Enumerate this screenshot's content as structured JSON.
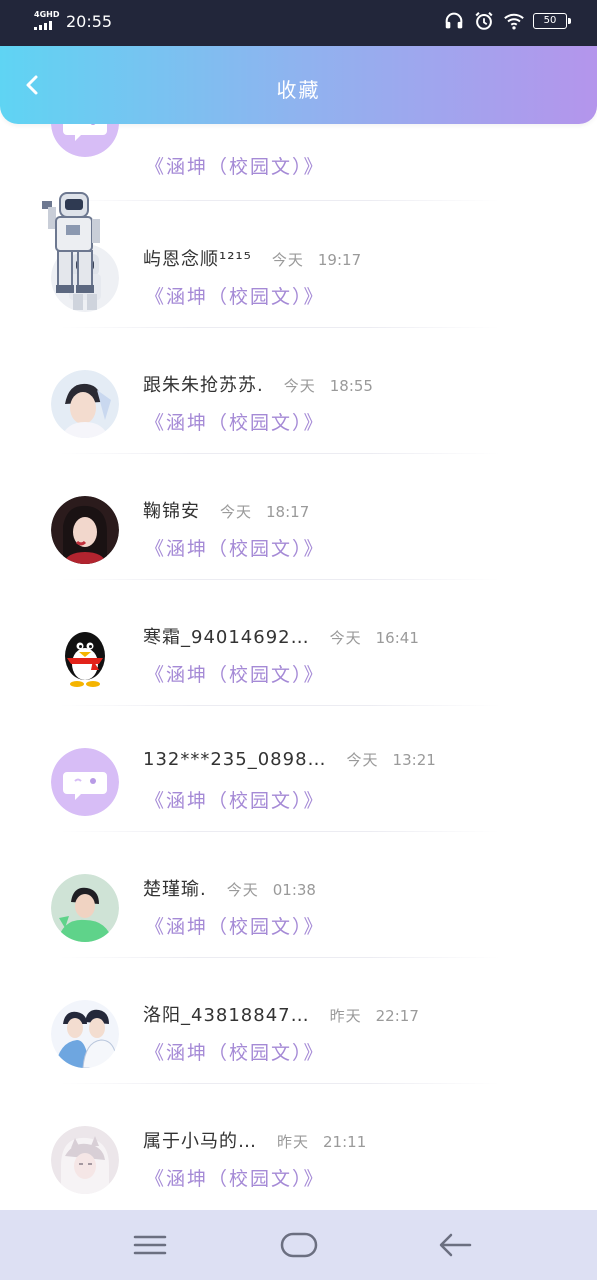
{
  "status_bar": {
    "network": "4GHD",
    "time": "20:55",
    "battery": "50"
  },
  "header": {
    "title": "收藏"
  },
  "items": [
    {
      "name": "",
      "when": "",
      "clock": "",
      "book": "《涵坤（校园文）》"
    },
    {
      "name": "屿恩念顺¹²¹⁵",
      "when": "今天",
      "clock": "19:17",
      "book": "《涵坤（校园文）》"
    },
    {
      "name": "跟朱朱抢苏苏.",
      "when": "今天",
      "clock": "18:55",
      "book": "《涵坤（校园文）》"
    },
    {
      "name": "鞠锦安",
      "when": "今天",
      "clock": "18:17",
      "book": "《涵坤（校园文）》"
    },
    {
      "name": "寒霜_94014692…",
      "when": "今天",
      "clock": "16:41",
      "book": "《涵坤（校园文）》"
    },
    {
      "name": "132***235_0898…",
      "when": "今天",
      "clock": "13:21",
      "book": "《涵坤（校园文）》"
    },
    {
      "name": "楚瑾瑜.",
      "when": "今天",
      "clock": "01:38",
      "book": "《涵坤（校园文）》"
    },
    {
      "name": "洛阳_43818847…",
      "when": "昨天",
      "clock": "22:17",
      "book": "《涵坤（校园文）》"
    },
    {
      "name": "属于小马的…",
      "when": "昨天",
      "clock": "21:11",
      "book": "《涵坤（校园文）》"
    }
  ],
  "icons": {
    "back": "chevron-left-icon",
    "menu": "menu-icon",
    "home": "home-icon",
    "nav_back": "back-arrow-icon"
  },
  "colors": {
    "header_start": "#5fd4f3",
    "header_end": "#b495ec",
    "accent_text": "#a58ad6",
    "nav_bg": "#dde0f3"
  }
}
